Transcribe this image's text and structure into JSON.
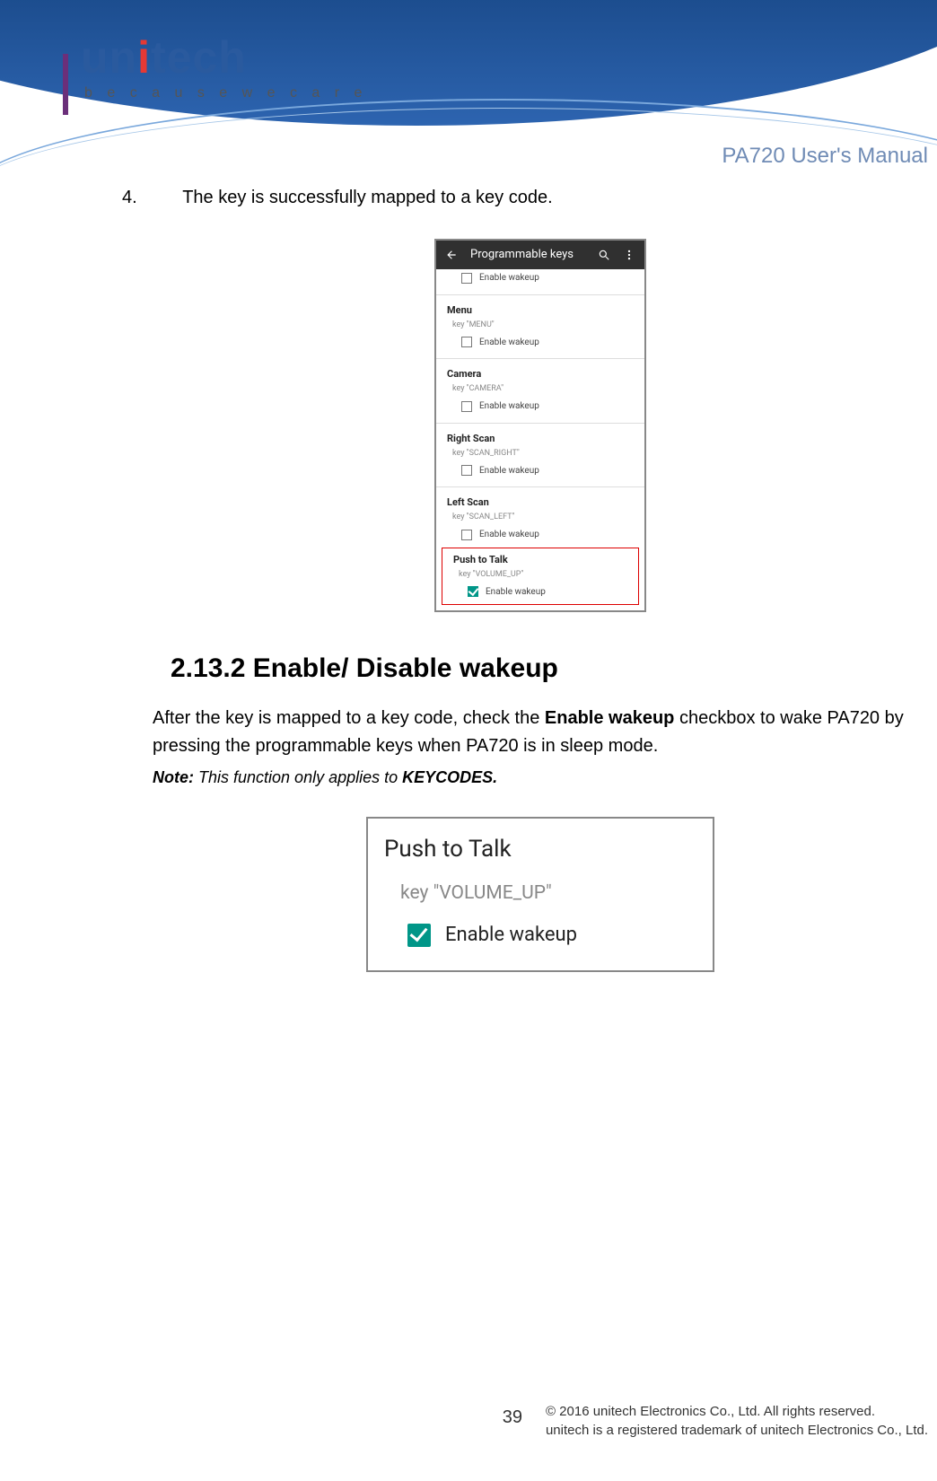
{
  "brand": {
    "name_prefix": "un",
    "name_mid": "i",
    "name_suffix": "tech",
    "tagline": "b e c a u s e   w e   c a r e"
  },
  "doc_title": "PA720 User's Manual",
  "step": {
    "number": "4.",
    "text": "The key is successfully mapped to a key code."
  },
  "screenshot1": {
    "header_title": "Programmable keys",
    "groups": [
      {
        "checkbox_label": "Enable wakeup",
        "checked": false,
        "no_cat": true
      },
      {
        "cat": "Menu",
        "sub": "key \"MENU\"",
        "checkbox_label": "Enable wakeup",
        "checked": false
      },
      {
        "cat": "Camera",
        "sub": "key \"CAMERA\"",
        "checkbox_label": "Enable wakeup",
        "checked": false
      },
      {
        "cat": "Right Scan",
        "sub": "key \"SCAN_RIGHT\"",
        "checkbox_label": "Enable wakeup",
        "checked": false
      },
      {
        "cat": "Left Scan",
        "sub": "key \"SCAN_LEFT\"",
        "checkbox_label": "Enable wakeup",
        "checked": false
      }
    ],
    "highlight": {
      "cat": "Push to Talk",
      "sub": "key \"VOLUME_UP\"",
      "checkbox_label": "Enable wakeup",
      "checked": true
    }
  },
  "section": {
    "heading": "2.13.2 Enable/ Disable wakeup",
    "para_before": "After the key is mapped to a key code, check the ",
    "para_bold": "Enable wakeup",
    "para_after": " checkbox to wake PA720 by pressing the programmable keys when PA720 is in sleep mode.",
    "note_label": "Note:",
    "note_text": " This function only applies to ",
    "note_keyword": "KEYCODES."
  },
  "screenshot2": {
    "title": "Push to Talk",
    "sub": "key \"VOLUME_UP\"",
    "checkbox_label": "Enable wakeup",
    "checked": true
  },
  "footer": {
    "page": "39",
    "line1": "© 2016 unitech Electronics Co., Ltd. All rights reserved.",
    "line2": "unitech is a registered trademark of unitech Electronics Co., Ltd."
  }
}
